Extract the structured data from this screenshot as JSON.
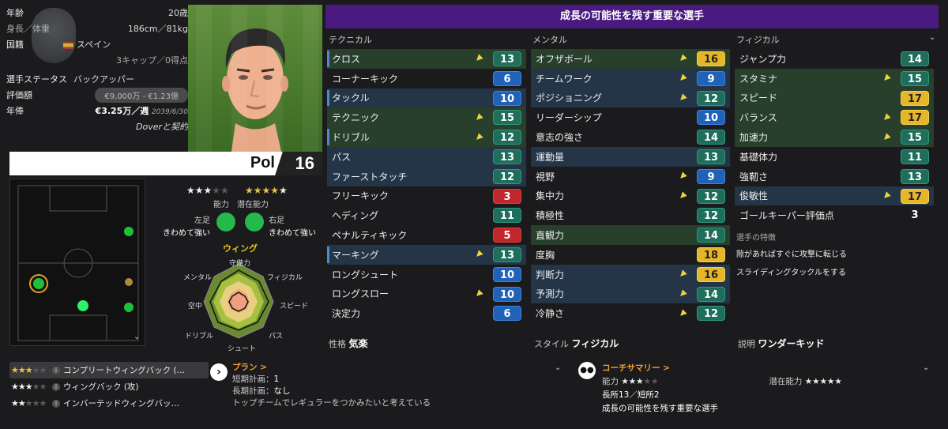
{
  "profile": {
    "age_label": "年齢",
    "age_value": "20歳",
    "height_label": "身長／体重",
    "height_value": "186cm／81kg",
    "nation_label": "国籍",
    "nation_value": "スペイン",
    "caps_value": "3キャップ／0得点",
    "status_label": "選手ステータス",
    "status_value": "バックアッパー",
    "valuation_label": "評価額",
    "valuation_value": "€9,000万 - €1.23億",
    "wage_label": "年俸",
    "wage_value": "€3.25万／週",
    "contract_end": "2039/6/30",
    "contract_text": "Doverと契約"
  },
  "player": {
    "name": "Pol",
    "number": "16"
  },
  "ratings": {
    "ability_label": "能力",
    "potential_label": "潜在能力",
    "ability_stars": 3,
    "potential_stars": 4.5,
    "left_foot_label": "左足",
    "left_foot_value": "きわめて強い",
    "right_foot_label": "右足",
    "right_foot_value": "きわめて強い",
    "position": "ウィング"
  },
  "radar": {
    "labels": [
      "守備力",
      "フィジカル",
      "スピード",
      "パス",
      "シュート",
      "ドリブル",
      "空中",
      "メンタル"
    ]
  },
  "attributes_panel": {
    "title": "成長の可能性を残す重要な選手",
    "col1_title": "テクニカル",
    "col2_title": "メンタル",
    "col3_title": "フィジカル"
  },
  "technical": [
    {
      "name": "クロス",
      "value": "13",
      "color": "g",
      "arrow": true,
      "hl": "hl",
      "bar": true
    },
    {
      "name": "コーナーキック",
      "value": "6",
      "color": "b",
      "arrow": false,
      "hl": "",
      "bar": false
    },
    {
      "name": "タックル",
      "value": "10",
      "color": "b",
      "arrow": false,
      "hl": "hlb",
      "bar": true
    },
    {
      "name": "テクニック",
      "value": "15",
      "color": "g",
      "arrow": true,
      "hl": "hl",
      "bar": false
    },
    {
      "name": "ドリブル",
      "value": "12",
      "color": "g",
      "arrow": true,
      "hl": "hl",
      "bar": true
    },
    {
      "name": "パス",
      "value": "13",
      "color": "g",
      "arrow": false,
      "hl": "hlb",
      "bar": false
    },
    {
      "name": "ファーストタッチ",
      "value": "12",
      "color": "g",
      "arrow": false,
      "hl": "hlb",
      "bar": false
    },
    {
      "name": "フリーキック",
      "value": "3",
      "color": "r",
      "arrow": false,
      "hl": "",
      "bar": false
    },
    {
      "name": "ヘディング",
      "value": "11",
      "color": "g",
      "arrow": false,
      "hl": "",
      "bar": false
    },
    {
      "name": "ペナルティキック",
      "value": "5",
      "color": "r",
      "arrow": false,
      "hl": "",
      "bar": false
    },
    {
      "name": "マーキング",
      "value": "13",
      "color": "g",
      "arrow": true,
      "hl": "hlb",
      "bar": true
    },
    {
      "name": "ロングシュート",
      "value": "10",
      "color": "b",
      "arrow": false,
      "hl": "",
      "bar": false
    },
    {
      "name": "ロングスロー",
      "value": "10",
      "color": "b",
      "arrow": true,
      "hl": "",
      "bar": false
    },
    {
      "name": "決定力",
      "value": "6",
      "color": "b",
      "arrow": false,
      "hl": "",
      "bar": false
    }
  ],
  "mental": [
    {
      "name": "オフザボール",
      "value": "16",
      "color": "y",
      "arrow": true,
      "hl": "hl",
      "bar": false
    },
    {
      "name": "チームワーク",
      "value": "9",
      "color": "b",
      "arrow": true,
      "hl": "hlb",
      "bar": false
    },
    {
      "name": "ポジショニング",
      "value": "12",
      "color": "g",
      "arrow": true,
      "hl": "hlb",
      "bar": false
    },
    {
      "name": "リーダーシップ",
      "value": "10",
      "color": "b",
      "arrow": false,
      "hl": "",
      "bar": false
    },
    {
      "name": "意志の強さ",
      "value": "14",
      "color": "g",
      "arrow": false,
      "hl": "",
      "bar": false
    },
    {
      "name": "運動量",
      "value": "13",
      "color": "g",
      "arrow": false,
      "hl": "hlb",
      "bar": false
    },
    {
      "name": "視野",
      "value": "9",
      "color": "b",
      "arrow": true,
      "hl": "",
      "bar": false
    },
    {
      "name": "集中力",
      "value": "12",
      "color": "g",
      "arrow": true,
      "hl": "",
      "bar": false
    },
    {
      "name": "積極性",
      "value": "12",
      "color": "g",
      "arrow": false,
      "hl": "",
      "bar": false
    },
    {
      "name": "直観力",
      "value": "14",
      "color": "g",
      "arrow": false,
      "hl": "hl",
      "bar": false
    },
    {
      "name": "度胸",
      "value": "18",
      "color": "y",
      "arrow": false,
      "hl": "",
      "bar": false
    },
    {
      "name": "判断力",
      "value": "16",
      "color": "y",
      "arrow": true,
      "hl": "hlb",
      "bar": false
    },
    {
      "name": "予測力",
      "value": "14",
      "color": "g",
      "arrow": true,
      "hl": "hlb",
      "bar": false
    },
    {
      "name": "冷静さ",
      "value": "12",
      "color": "g",
      "arrow": true,
      "hl": "",
      "bar": false
    }
  ],
  "physical": [
    {
      "name": "ジャンプ力",
      "value": "14",
      "color": "g",
      "arrow": false,
      "hl": "",
      "bar": false
    },
    {
      "name": "スタミナ",
      "value": "15",
      "color": "g",
      "arrow": true,
      "hl": "hl",
      "bar": false
    },
    {
      "name": "スピード",
      "value": "17",
      "color": "y",
      "arrow": false,
      "hl": "hl",
      "bar": false
    },
    {
      "name": "バランス",
      "value": "17",
      "color": "y",
      "arrow": true,
      "hl": "hl",
      "bar": false
    },
    {
      "name": "加速力",
      "value": "15",
      "color": "g",
      "arrow": true,
      "hl": "hl",
      "bar": false
    },
    {
      "name": "基礎体力",
      "value": "11",
      "color": "g",
      "arrow": false,
      "hl": "",
      "bar": false
    },
    {
      "name": "強靭さ",
      "value": "13",
      "color": "g",
      "arrow": false,
      "hl": "",
      "bar": false
    },
    {
      "name": "俊敏性",
      "value": "17",
      "color": "y",
      "arrow": true,
      "hl": "hlb",
      "bar": false
    },
    {
      "name": "ゴールキーパー評価点",
      "value": "3",
      "color": "plain",
      "arrow": false,
      "hl": "",
      "bar": false
    }
  ],
  "traits": {
    "title": "選手の特徴",
    "items": [
      "隙があればすぐに攻撃に転じる",
      "スライディングタックルをする"
    ]
  },
  "bottom_info": {
    "personality_label": "性格",
    "personality_value": "気楽",
    "style_label": "スタイル",
    "style_value": "フィジカル",
    "desc_label": "説明",
    "desc_value": "ワンダーキッド"
  },
  "roles": [
    {
      "stars": 3,
      "name": "コンプリートウィングバック (…"
    },
    {
      "stars": 3,
      "name": "ウィングバック (攻)"
    },
    {
      "stars": 2.5,
      "name": "インバーテッドウィングバッ…"
    }
  ],
  "plan": {
    "title": "プラン >",
    "short_label": "短期計画：",
    "short_value": "1",
    "long_label": "長期計画：",
    "long_value": "なし",
    "desc": "トップチームでレギュラーをつかみたいと考えている"
  },
  "coach": {
    "title": "コーチサマリー >",
    "ability_label": "能力",
    "potential_label": "潜在能力",
    "strengths": "長所13／短所2",
    "summary": "成長の可能性を残す重要な選手"
  }
}
